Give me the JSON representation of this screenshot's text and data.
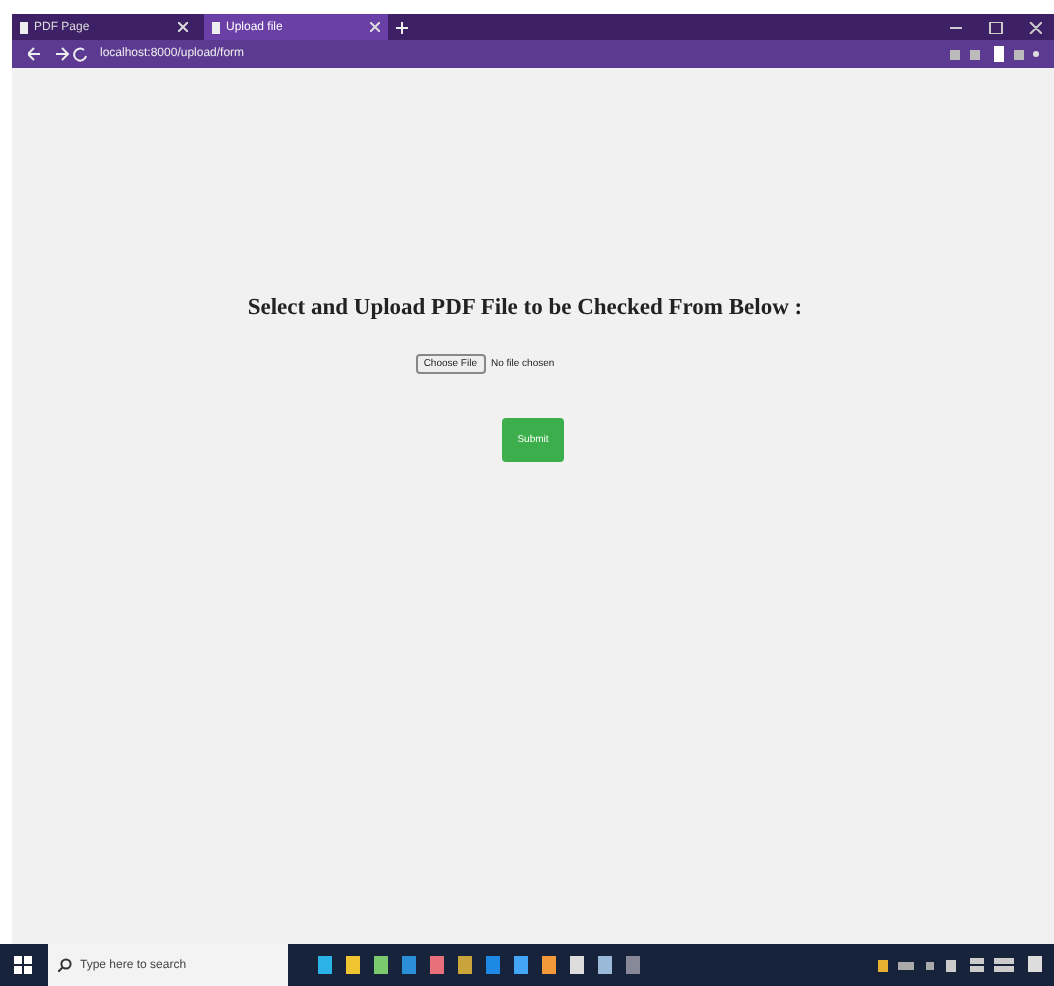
{
  "browser": {
    "tabs": [
      {
        "title": "PDF Page",
        "selected": false
      },
      {
        "title": "Upload file",
        "selected": true
      }
    ],
    "address": "localhost:8000/upload/form"
  },
  "page": {
    "heading": "Select and Upload PDF File to be Checked From Below :",
    "file_button": "Choose File",
    "file_status": "No file chosen",
    "submit": "Submit"
  },
  "taskbar": {
    "search_placeholder": "Type here to search"
  }
}
